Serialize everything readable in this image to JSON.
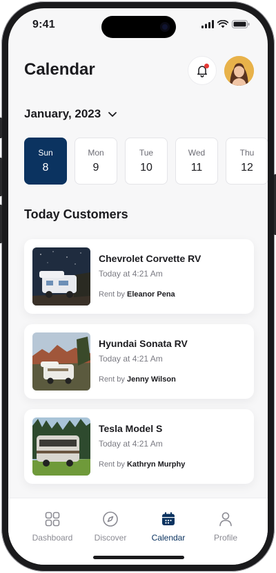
{
  "status_bar": {
    "time": "9:41"
  },
  "header": {
    "title": "Calendar"
  },
  "month_selector": {
    "label": "January, 2023"
  },
  "dates": [
    {
      "day": "Sun",
      "num": "8",
      "active": true
    },
    {
      "day": "Mon",
      "num": "9",
      "active": false
    },
    {
      "day": "Tue",
      "num": "10",
      "active": false
    },
    {
      "day": "Wed",
      "num": "11",
      "active": false
    },
    {
      "day": "Thu",
      "num": "12",
      "active": false
    }
  ],
  "section": {
    "title": "Today Customers"
  },
  "customers": [
    {
      "vehicle": "Chevrolet Corvette RV",
      "time": "Today at 4:21 Am",
      "rent_prefix": "Rent by",
      "renter": "Eleanor Pena"
    },
    {
      "vehicle": "Hyundai Sonata RV",
      "time": "Today at 4:21 Am",
      "rent_prefix": "Rent by",
      "renter": "Jenny Wilson"
    },
    {
      "vehicle": "Tesla Model S",
      "time": "Today at 4:21 Am",
      "rent_prefix": "Rent by",
      "renter": "Kathryn Murphy"
    }
  ],
  "tabs": [
    {
      "label": "Dashboard",
      "icon": "grid-icon",
      "active": false
    },
    {
      "label": "Discover",
      "icon": "compass-icon",
      "active": false
    },
    {
      "label": "Calendar",
      "icon": "calendar-icon",
      "active": true
    },
    {
      "label": "Profile",
      "icon": "user-icon",
      "active": false
    }
  ],
  "colors": {
    "primary": "#0b3360",
    "notification_dot": "#e53935",
    "background": "#f7f7f8"
  }
}
